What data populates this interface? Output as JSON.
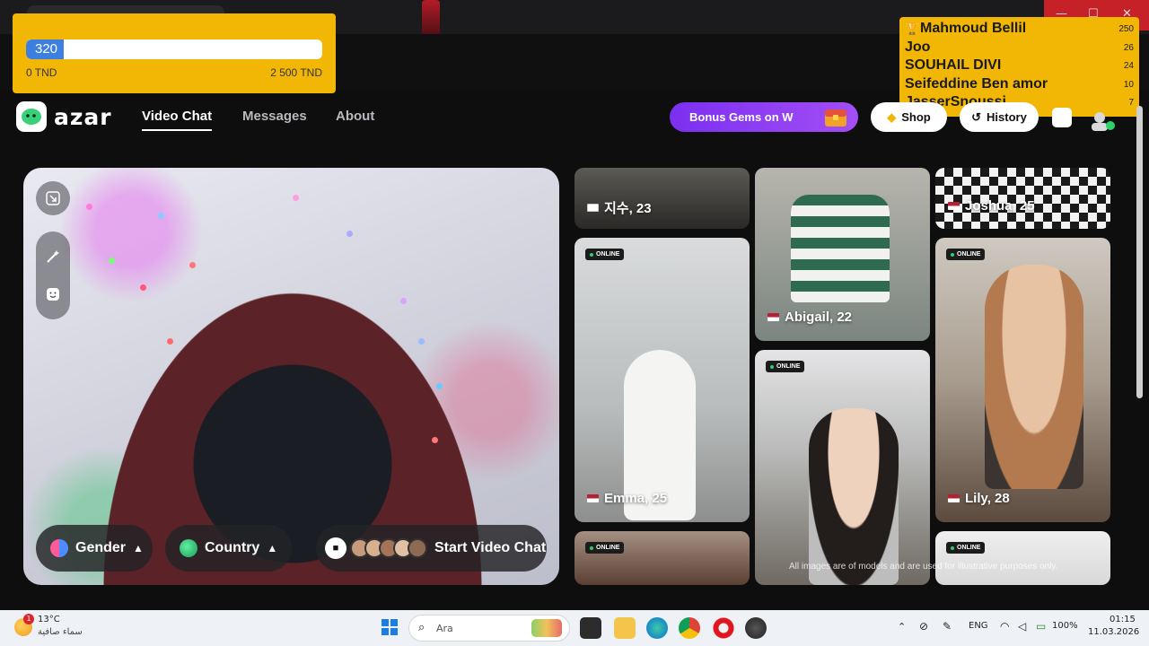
{
  "donation_goal": {
    "current_value": "320",
    "min_label": "0 TND",
    "max_label": "2 500 TND",
    "progress_fraction": 0.128
  },
  "leaderboard": [
    {
      "name": "Mahmoud Bellil",
      "score": "250"
    },
    {
      "name": "Joo",
      "score": "26"
    },
    {
      "name": "SOUHAIL DIVI",
      "score": "24"
    },
    {
      "name": "Seifeddine Ben amor",
      "score": "10"
    },
    {
      "name": "JasserSnoussi",
      "score": "7"
    }
  ],
  "header": {
    "logo_text": "azar",
    "nav": [
      "Video Chat",
      "Messages",
      "About"
    ],
    "bonus_label": "Bonus Gems on W",
    "shop_label": "Shop",
    "history_label": "History"
  },
  "video_panel": {
    "gender_label": "Gender",
    "country_label": "Country",
    "start_label": "Start Video Chat"
  },
  "profiles": [
    {
      "label": "지수, 23",
      "online": ""
    },
    {
      "label": "Abigail, 22",
      "online": ""
    },
    {
      "label": "Joshua, 25",
      "online": ""
    },
    {
      "label": "Emma, 25",
      "online": "ONLINE"
    },
    {
      "label": "Lily, 28",
      "online": "ONLINE"
    },
    {
      "label": "",
      "online": "ONLINE"
    },
    {
      "label": "",
      "online": "ONLINE"
    },
    {
      "label": "",
      "online": "ONLINE"
    }
  ],
  "disclaimer": "All images are of models and are used for illustrative purposes only.",
  "taskbar": {
    "temperature": "13°C",
    "weather": "سماء صافية",
    "weather_badge": "1",
    "search_placeholder": "Ara",
    "language": "ENG",
    "battery": "100%",
    "time": "01:15",
    "date": "11.03.2026"
  },
  "colors": {
    "overlay_yellow": "#f2b705",
    "progress_blue": "#3d7fe0",
    "bonus_purple": "#8a3cf3",
    "online_green": "#29d36a"
  }
}
